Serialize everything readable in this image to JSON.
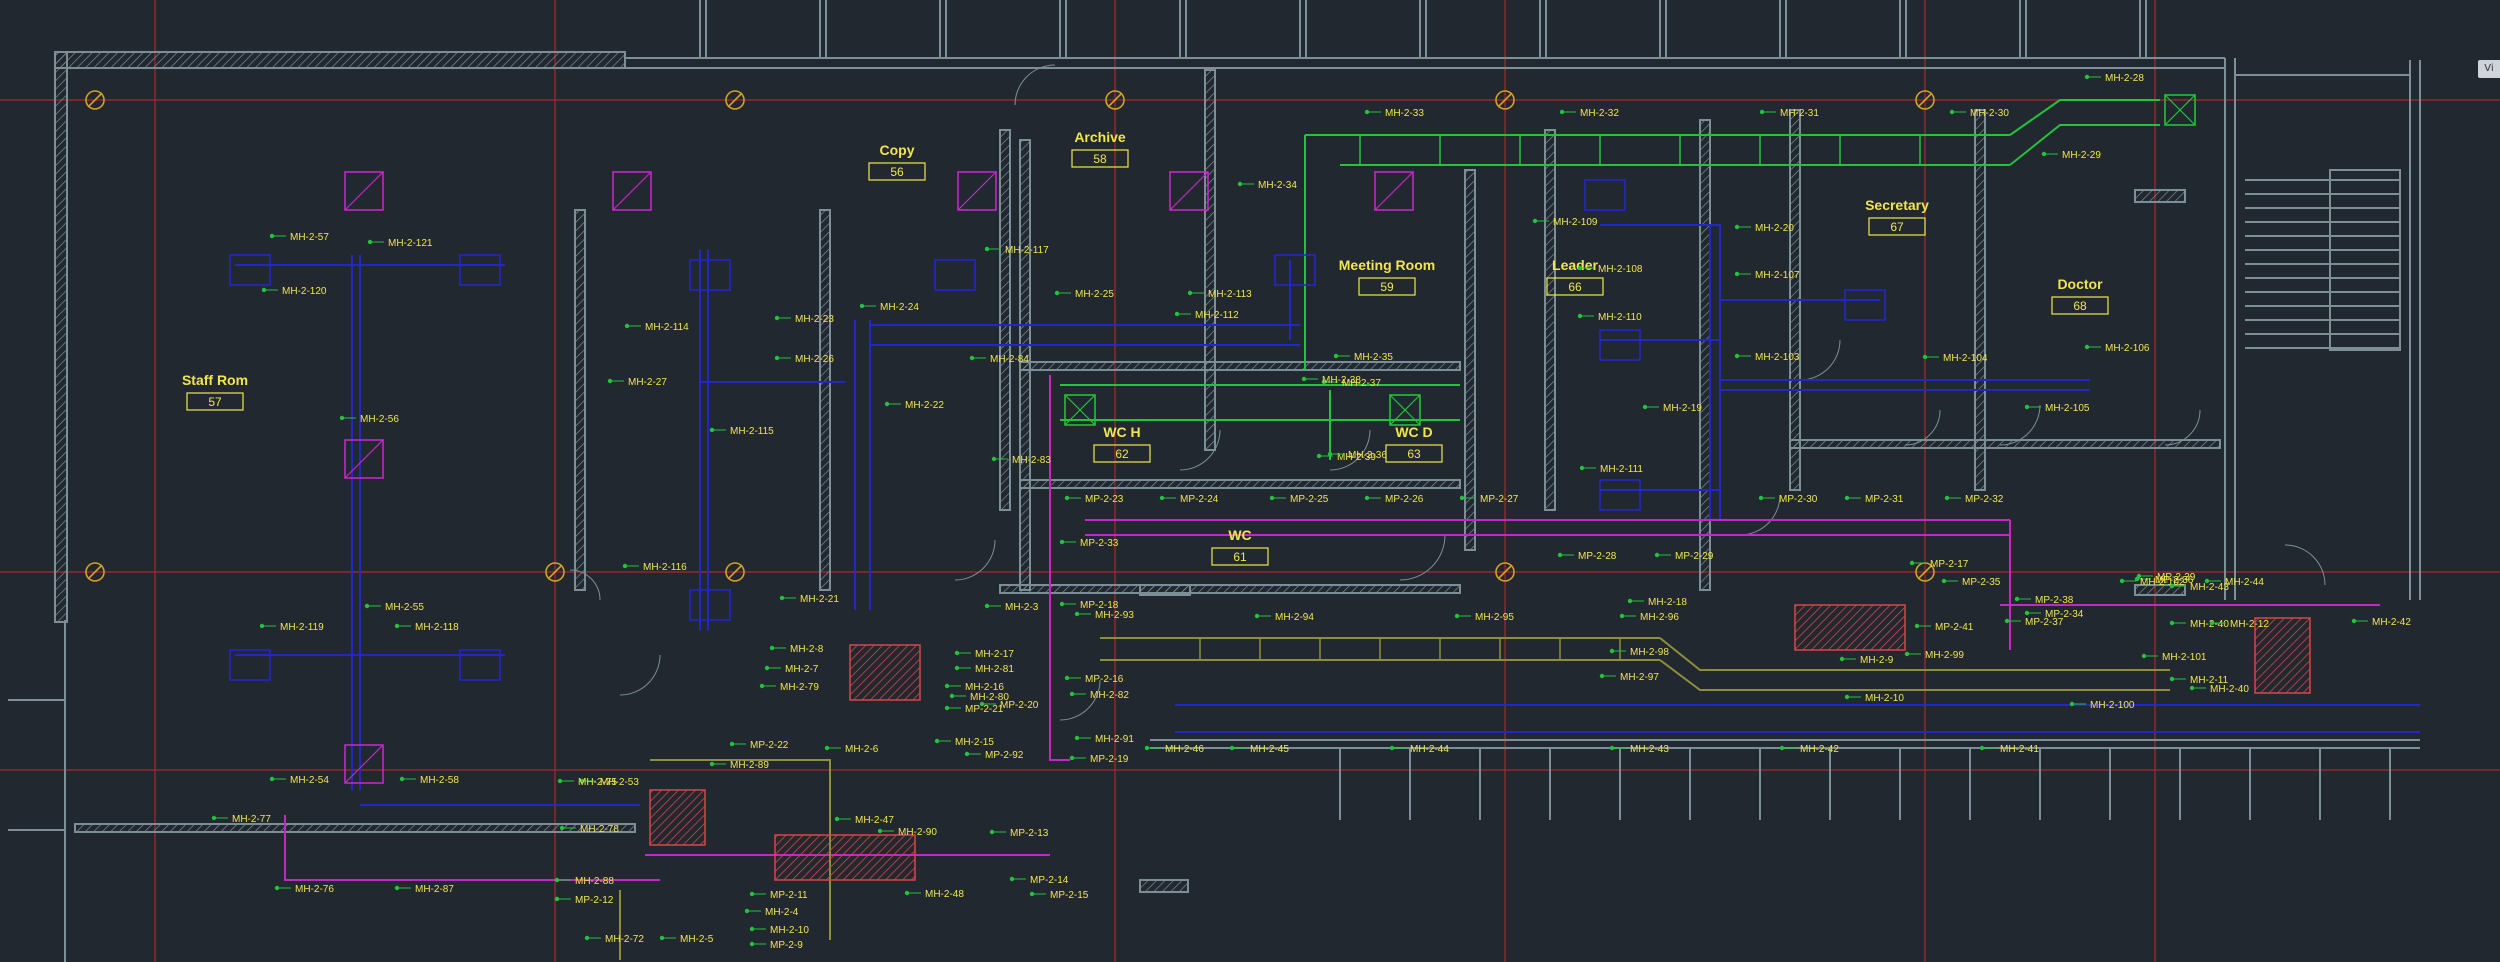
{
  "colors": {
    "background": "#212830",
    "wall": "#7d8f96",
    "wall_hatch": "#6f7f86",
    "gridline": "#c22a2a",
    "column": "#d4a024",
    "duct_supply": "#2326c8",
    "duct_exhaust": "#21c43a",
    "duct_return": "#c526c8",
    "duct_outdoor": "#8f8f3b",
    "equipment": "#d84545",
    "room_label": "#f2e64a",
    "tag_text": "#f2e64a",
    "tag_leader": "#21c43a"
  },
  "viewport_button": {
    "label": "Vi",
    "icon": "viewcube-icon"
  },
  "rooms": [
    {
      "name": "Staff Rom",
      "number": "57"
    },
    {
      "name": "Copy",
      "number": "56"
    },
    {
      "name": "Archive",
      "number": "58"
    },
    {
      "name": "Meeting Room",
      "number": "59"
    },
    {
      "name": "Leader",
      "number": "66"
    },
    {
      "name": "Secretary",
      "number": "67"
    },
    {
      "name": "Doctor",
      "number": "68"
    },
    {
      "name": "WC H",
      "number": "62"
    },
    {
      "name": "WC D",
      "number": "63"
    },
    {
      "name": "WC",
      "number": "61"
    }
  ],
  "tags": [
    "MH-2-57",
    "MH-2-121",
    "MH-2-120",
    "MH-2-56",
    "MH-2-55",
    "MH-2-119",
    "MH-2-118",
    "MH-2-54",
    "MH-2-58",
    "MH-2-114",
    "MH-2-27",
    "MH-2-115",
    "MH-2-116",
    "MH-2-23",
    "MH-2-26",
    "MH-2-24",
    "MH-2-22",
    "MH-2-21",
    "MH-2-117",
    "MH-2-25",
    "MH-2-84",
    "MH-2-113",
    "MH-2-112",
    "MH-2-33",
    "MH-2-34",
    "MH-2-32",
    "MH-2-31",
    "MH-2-30",
    "MH-2-28",
    "MH-2-29",
    "MH-2-109",
    "MH-2-108",
    "MH-2-20",
    "MH-2-107",
    "MH-2-110",
    "MH-2-103",
    "MH-2-19",
    "MH-2-104",
    "MH-2-106",
    "MH-2-105",
    "MH-2-111",
    "MH-2-35",
    "MH-2-37",
    "MH-2-38",
    "MH-2-39",
    "MH-2-36",
    "MH-2-83",
    "MP-2-23",
    "MP-2-24",
    "MP-2-25",
    "MP-2-26",
    "MP-2-27",
    "MP-2-28",
    "MP-2-29",
    "MP-2-30",
    "MP-2-31",
    "MP-2-32",
    "MP-2-33",
    "MP-2-18",
    "MP-2-17",
    "MP-2-35",
    "MP-2-36",
    "MH-2-102",
    "MP-2-39",
    "MH-2-43",
    "MH-2-44",
    "MP-2-38",
    "MP-2-34",
    "MP-2-37",
    "MP-2-41",
    "MH-2-40",
    "MH-2-12",
    "MH-2-11",
    "MH-2-42",
    "MH-2-101",
    "MH-2-100",
    "MH-2-40",
    "MH-2-9",
    "MH-2-99",
    "MH-2-10",
    "MH-2-18",
    "MH-2-93",
    "MH-2-94",
    "MH-2-95",
    "MH-2-96",
    "MH-2-98",
    "MH-2-97",
    "MP-2-16",
    "MH-2-82",
    "MH-2-91",
    "MP-2-19",
    "MH-2-46",
    "MH-2-45",
    "MH-2-44",
    "MH-2-43",
    "MH-2-42",
    "MH-2-41",
    "MH-2-8",
    "MH-2-7",
    "MH-2-79",
    "MH-2-17",
    "MH-2-81",
    "MH-2-16",
    "MH-2-80",
    "MP-2-21",
    "MH-2-6",
    "MP-2-22",
    "MH-2-89",
    "MH-2-15",
    "MP-2-92",
    "MP-2-20",
    "MH-2-3",
    "MH-2-53",
    "MH-2-75",
    "MH-2-78",
    "MH-2-77",
    "MH-2-76",
    "MH-2-87",
    "MH-2-88",
    "MP-2-12",
    "MP-2-11",
    "MH-2-4",
    "MH-2-10",
    "MP-2-9",
    "MH-2-72",
    "MH-2-5",
    "MH-2-47",
    "MH-2-90",
    "MP-2-13",
    "MH-2-48",
    "MP-2-14",
    "MP-2-15"
  ]
}
